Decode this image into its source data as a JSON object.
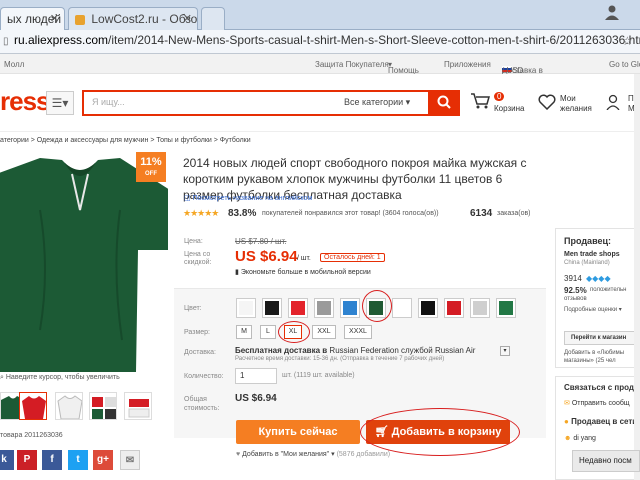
{
  "browser": {
    "tabs": [
      {
        "label": "ых людей с",
        "active": true
      },
      {
        "label": "LowCost2.ru - Обзор",
        "active": false
      }
    ],
    "user_icon": "user-icon",
    "url_prefix": "ru.aliexpress.com",
    "url_rest": "/item/2014-New-Mens-Sports-casual-t-shirt-Men-s-Short-Sleeve-cotton-men-t-shirt-6/2011263036.html"
  },
  "topnav": {
    "mall": "Молл",
    "protection": "Защита Покупателя",
    "help": "Помощь",
    "apps": "Приложения",
    "delivery": "Доставка в",
    "currency": "/ USD",
    "global": "Go to Glo"
  },
  "header": {
    "logo": "ress",
    "search_placeholder": "Я ищу...",
    "search_category": "Все категории",
    "cart_count": "0",
    "cart_label": "Корзина",
    "wish_label1": "Мои",
    "wish_label2": "желания",
    "profile_label1": "Пр",
    "profile_label2": "Мо"
  },
  "breadcrumb": "атегории > Одежда и аксессуары для мужчин > Топы и футболки > Футболки",
  "gallery": {
    "discount": "11%",
    "discount_sub": "OFF",
    "hint": "Наведите курсор, чтобы увеличить",
    "item_no": "товара 2011263036"
  },
  "product": {
    "title": "2014 новых людей спорт свободного покроя майка мужская с коротким рукавом хлопок мужчины футболки 11 цветов 6 размер футболки бесплатная доставка",
    "translate_link": "Посмотреть название на английском",
    "rating_pct": "83.8%",
    "rating_text": "покупателей понравился этот товар! (3604 голоса(ов))",
    "orders_count": "6134",
    "orders_label": "заказа(ов)",
    "price_label": "Цена:",
    "old_price": "US $7.80 / шт.",
    "discount_label1": "Цена со",
    "discount_label2": "скидкой:",
    "price": "US $6.94",
    "price_unit": "/ шт.",
    "days_left": "Осталось дней: 1",
    "mobile_save": "Экономьте больше в мобильной версии",
    "color_label": "Цвет:",
    "size_label": "Размер:",
    "sizes": [
      "M",
      "L",
      "XL",
      "XXL",
      "XXXL"
    ],
    "ship_label": "Доставка:",
    "ship_text": "Бесплатная доставка в",
    "ship_country": "Russian Federation службой Russian Air",
    "ship_time": "Расчетное время доставки: 15-36 дн. (Отправка в течение 7 рабочих дней)",
    "qty_label": "Количество:",
    "qty_value": "1",
    "qty_avail": "шт. (1119 шт. available)",
    "total_label1": "Общая",
    "total_label2": "стоимость:",
    "total": "US $6.94",
    "buy_now": "Купить сейчас",
    "add_to_cart": "Добавить в корзину",
    "wishlist": "Добавить в \"Мои желания\"",
    "wish_count": "(5876 добавили)"
  },
  "colors": [
    "#f5f5f5",
    "#1a1a1a",
    "#e3232b",
    "#9a9a9a",
    "#2f83d0",
    "#1f5a33",
    "#ffffff",
    "#111111",
    "#d41c24",
    "#cfcfcf",
    "#227845"
  ],
  "seller": {
    "title": "Продавец:",
    "name": "Men trade shops",
    "location": "China (Mainland)",
    "score": "3914",
    "positive": "92.5%",
    "positive_text1": "положительн",
    "positive_text2": "отзывов",
    "details": "Подробные оценки",
    "store_button": "Перейти к магазин",
    "fav1": "Добавить в «Любимы",
    "fav2": "магазины» (25 чел"
  },
  "side": {
    "contact": "Связаться с прод",
    "message": "Отправить сообщ",
    "online": "Продавец в сети",
    "seller_name": "di yang"
  },
  "footer_popup": "Недавно посм"
}
